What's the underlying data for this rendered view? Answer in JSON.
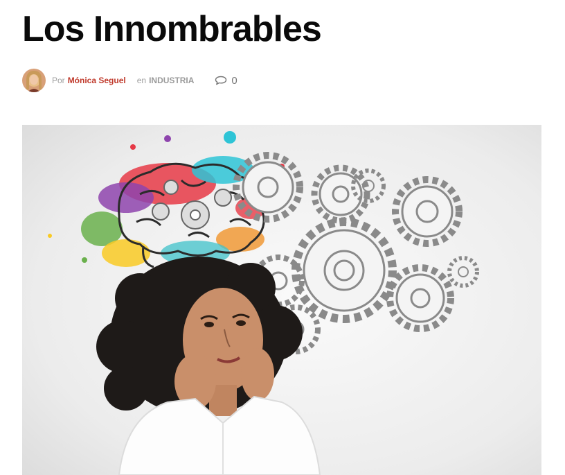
{
  "post": {
    "title": "Los Innombrables",
    "by_label": "Por",
    "author": "Mónica Seguel",
    "in_label": "en",
    "category": "INDUSTRIA",
    "comment_count": "0"
  },
  "icons": {
    "comments": "speech-bubble-icon"
  },
  "colors": {
    "author_link": "#c0392b",
    "meta_text": "#a0a0a0",
    "title": "#0a0a0a"
  }
}
